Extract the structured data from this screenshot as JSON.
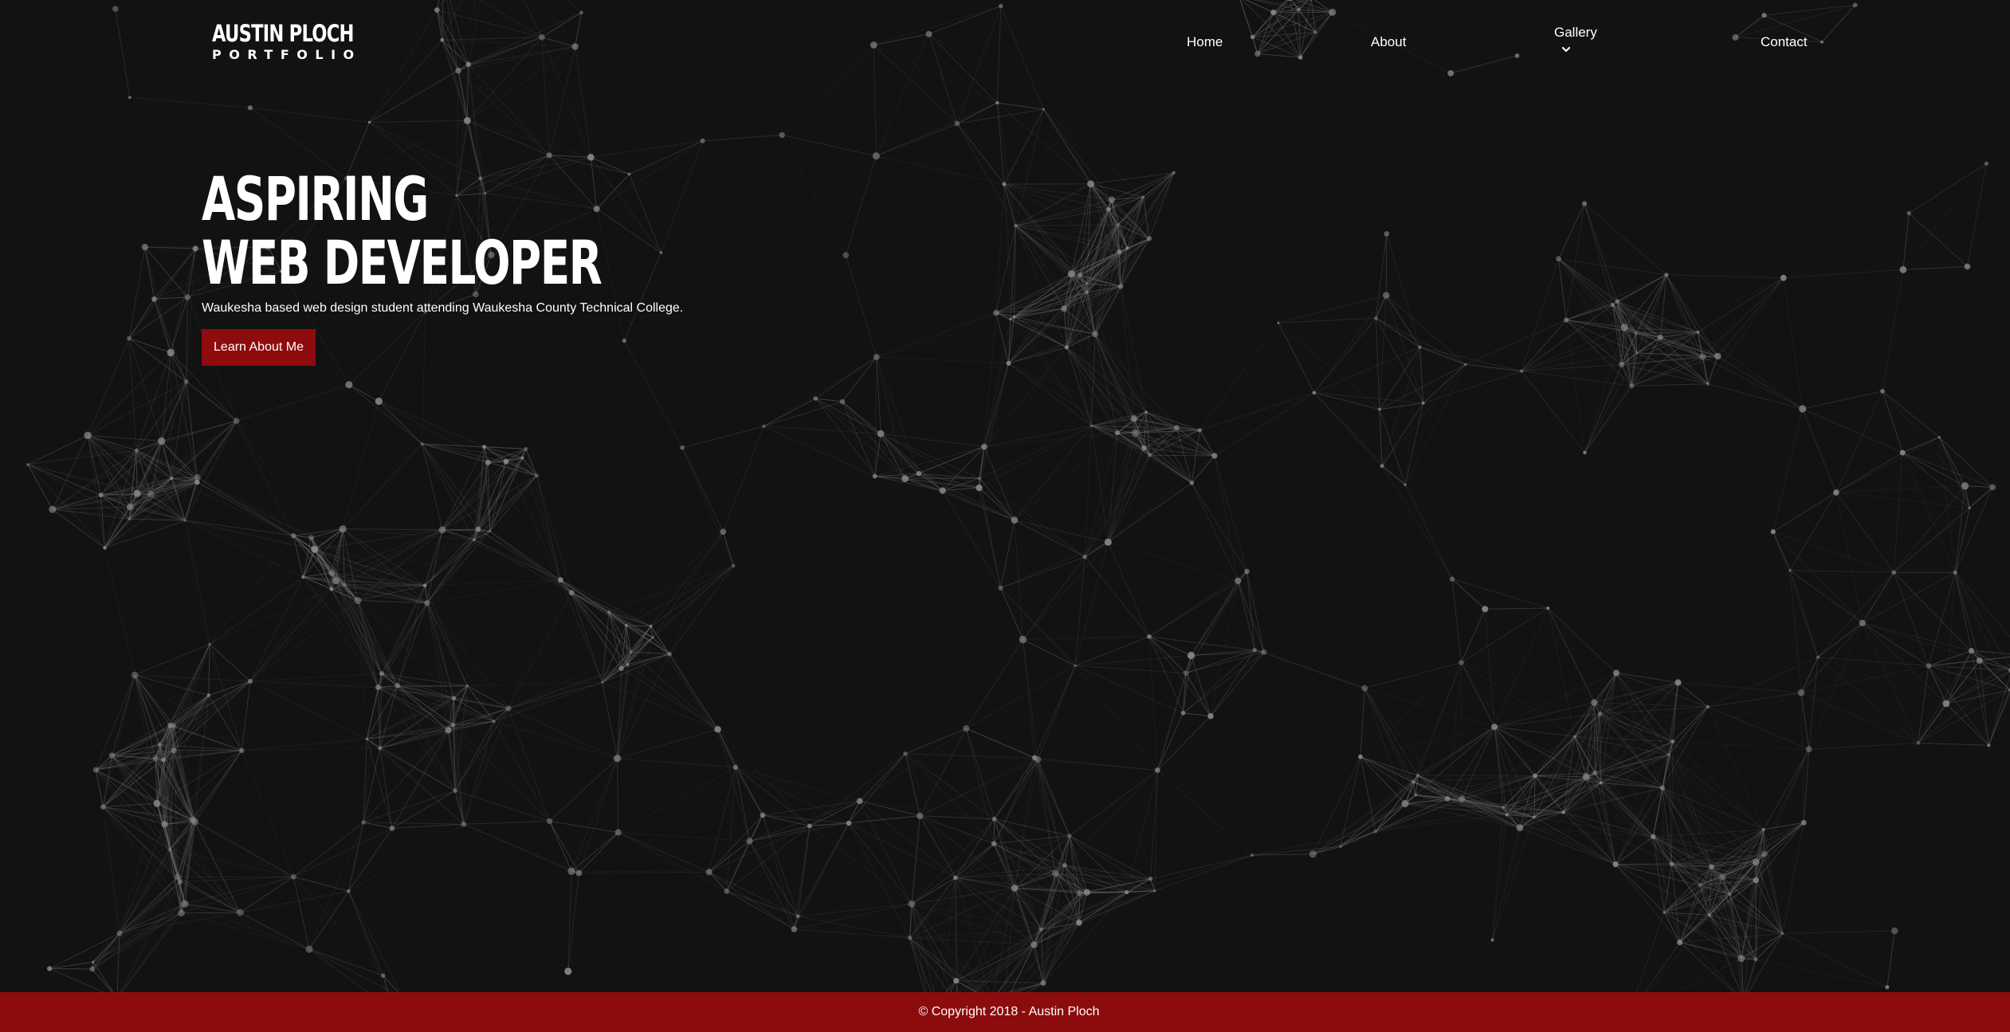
{
  "brand": {
    "name": "AUSTIN PLOCH",
    "subtitle": "PORTFOLIO"
  },
  "nav": {
    "home": "Home",
    "about": "About",
    "gallery": "Gallery",
    "contact": "Contact",
    "gallery_icon": "chevron-down-icon"
  },
  "hero": {
    "title_line1": "ASPIRING",
    "title_line2": "WEB DEVELOPER",
    "description": "Waukesha based web design student attending Waukesha County Technical College.",
    "button_label": "Learn About Me"
  },
  "footer": {
    "copyright": "© Copyright 2018 - Austin Ploch"
  },
  "colors": {
    "background": "#121212",
    "accent_red": "#8e0b0e",
    "text": "#ffffff",
    "network_lines": "#6a6a6a",
    "network_nodes": "#8a8a8a"
  }
}
